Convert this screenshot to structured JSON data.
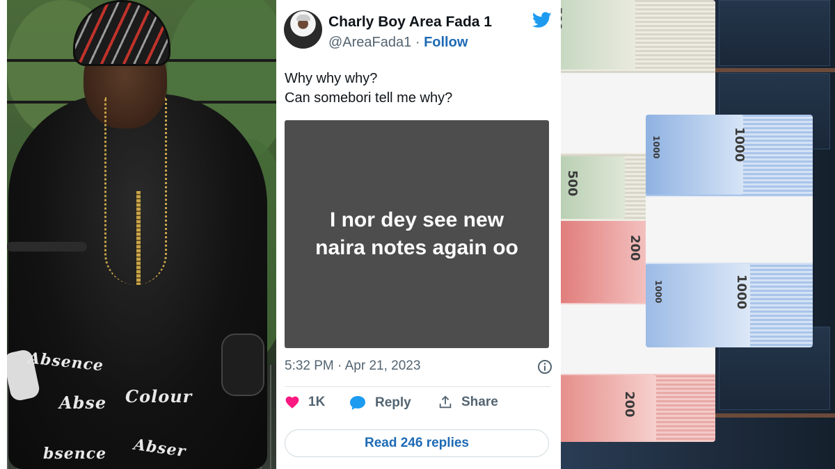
{
  "left_photo": {
    "pants_text": [
      "Absence",
      "Colour",
      "Abse",
      "bsence",
      "Abser"
    ],
    "colors": {
      "foliage": "#4b6a3a",
      "clothing": "#121212",
      "chain": "#c9a54a",
      "helmet_accent": "#c0332b"
    }
  },
  "tweet": {
    "display_name": "Charly Boy Area Fada 1",
    "handle": "@AreaFada1",
    "separator": "·",
    "follow_label": "Follow",
    "text_line1": "Why why why?",
    "text_line2": "Can somebori tell me why?",
    "media_text": "I nor dey see new\nnaira notes again oo",
    "timestamp": "5:32 PM · Apr 21, 2023",
    "likes_count": "1K",
    "reply_label": "Reply",
    "share_label": "Share",
    "read_replies_label": "Read 246 replies",
    "icons": [
      "twitter-bird-icon",
      "info-icon",
      "heart-icon",
      "reply-bubble-icon",
      "share-icon"
    ],
    "colors": {
      "accent": "#1d9bf0",
      "link": "#1d6ab5",
      "heart": "#f91880",
      "text": "#0f1419",
      "muted": "#536471",
      "media_bg": "#4d4d4d"
    }
  },
  "right_photo": {
    "denominations": [
      "500",
      "500",
      "1000",
      "1000",
      "200",
      "200",
      "1000",
      "1000"
    ],
    "colors": {
      "note_500": "#d8d6c9",
      "note_200": "#e8a9a7",
      "note_1000": "#a9c4ea",
      "background": "#1d2a3b"
    }
  }
}
